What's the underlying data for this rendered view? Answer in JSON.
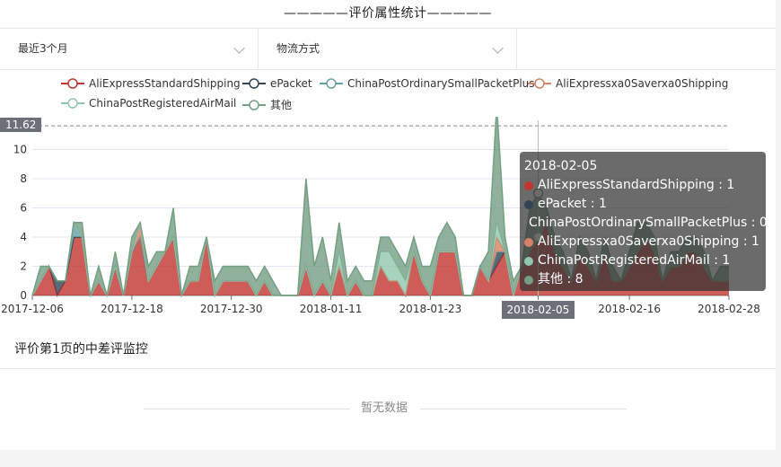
{
  "page": {
    "title": "—————评价属性统计—————"
  },
  "filters": [
    {
      "label": "最近3个月"
    },
    {
      "label": "物流方式"
    },
    {
      "label": ""
    }
  ],
  "chart_data": {
    "type": "area",
    "stacked": true,
    "ylim": [
      0,
      12
    ],
    "yticks": [
      0,
      2,
      4,
      6,
      8,
      10
    ],
    "grid": true,
    "legend_position": "top",
    "x_start": "2017-12-06",
    "x_tick_labels": [
      "2017-12-06",
      "2017-12-18",
      "2017-12-30",
      "2018-01-11",
      "2018-01-23",
      "2018-02-05",
      "2018-02-16",
      "2018-02-28"
    ],
    "max_marker": 11.62,
    "highlight_date": "2018-02-05",
    "series": [
      {
        "name": "AliExpressStandardShipping",
        "color": "#c23531",
        "values": [
          0,
          1,
          2,
          0,
          1,
          4,
          4,
          0,
          1,
          0,
          2,
          0,
          3,
          4,
          1,
          2,
          3,
          4,
          0,
          1,
          1,
          4,
          0,
          1,
          1,
          1,
          1,
          0,
          1,
          0,
          0,
          0,
          0,
          2,
          0,
          1,
          0,
          2,
          0,
          1,
          0,
          0,
          2,
          1,
          1,
          0,
          3,
          1,
          0,
          3,
          3,
          3,
          0,
          0,
          2,
          1,
          2,
          3,
          0,
          2,
          3,
          4,
          5,
          3,
          2,
          1,
          3,
          2,
          1,
          3,
          1,
          1,
          2,
          3,
          4,
          3,
          1,
          2,
          2,
          3,
          3,
          2,
          1,
          1,
          1
        ]
      },
      {
        "name": "ePacket",
        "color": "#2f4554",
        "values": [
          0,
          0,
          0,
          1,
          0,
          0,
          0,
          0,
          0,
          0,
          0,
          0,
          0,
          0,
          0,
          0,
          0,
          0,
          0,
          0,
          0,
          0,
          0,
          0,
          0,
          0,
          0,
          0,
          0,
          0,
          0,
          0,
          0,
          0,
          0,
          0,
          0,
          0,
          0,
          0,
          0,
          0,
          0,
          0,
          0,
          0,
          0,
          0,
          0,
          0,
          0,
          0,
          0,
          0,
          0,
          0,
          1,
          0,
          0,
          0,
          0,
          0,
          0,
          0,
          0,
          0,
          0,
          0,
          0,
          0,
          0,
          0,
          0,
          0,
          0,
          0,
          0,
          0,
          0,
          0,
          0,
          0,
          0,
          0,
          0
        ]
      },
      {
        "name": "ChinaPostOrdinarySmallPacketPlus",
        "color": "#61a0a8",
        "values": [
          0,
          0,
          0,
          0,
          0,
          1,
          0,
          0,
          0,
          0,
          0,
          0,
          0,
          0,
          0,
          0,
          0,
          0,
          0,
          0,
          0,
          0,
          0,
          0,
          0,
          0,
          0,
          0,
          0,
          0,
          0,
          0,
          0,
          0,
          0,
          0,
          0,
          0,
          0,
          0,
          0,
          0,
          0,
          0,
          0,
          0,
          0,
          0,
          0,
          0,
          0,
          0,
          0,
          0,
          0,
          0,
          0,
          0,
          0,
          0,
          0,
          0,
          0,
          0,
          0,
          0,
          0,
          0,
          0,
          0,
          0,
          0,
          0,
          0,
          0,
          0,
          0,
          0,
          0,
          0,
          0,
          0,
          0,
          0,
          0
        ]
      },
      {
        "name": "AliExpressxa0Saverxa0Shipping",
        "color": "#d48265",
        "values": [
          0,
          0,
          0,
          0,
          0,
          0,
          0,
          0,
          0,
          0,
          0,
          0,
          0,
          1,
          0,
          0,
          0,
          0,
          0,
          0,
          0,
          0,
          0,
          0,
          0,
          0,
          0,
          0,
          0,
          0,
          0,
          0,
          0,
          0,
          0,
          0,
          0,
          0,
          0,
          0,
          0,
          0,
          0,
          0,
          0,
          0,
          0,
          0,
          0,
          0,
          0,
          0,
          0,
          0,
          0,
          0,
          1,
          0,
          0,
          0,
          0,
          0,
          0,
          0,
          0,
          0,
          0,
          0,
          0,
          0,
          0,
          0,
          0,
          0,
          0,
          0,
          0,
          0,
          0,
          0,
          0,
          0,
          0,
          0,
          0
        ]
      },
      {
        "name": "ChinaPostRegisteredAirMail",
        "color": "#91c7ae",
        "values": [
          0,
          0,
          0,
          0,
          0,
          0,
          0,
          0,
          0,
          0,
          0,
          0,
          0,
          0,
          0,
          0,
          0,
          0,
          0,
          0,
          0,
          0,
          0,
          0,
          0,
          0,
          0,
          0,
          0,
          0,
          0,
          0,
          0,
          0,
          0,
          0,
          0,
          1,
          0,
          0,
          0,
          0,
          1,
          2,
          1,
          1,
          0,
          0,
          0,
          0,
          0,
          0,
          0,
          0,
          0,
          0,
          1,
          0,
          0,
          0,
          0,
          0,
          0,
          0,
          0,
          0,
          0,
          0,
          0,
          0,
          0,
          0,
          0,
          0,
          0,
          0,
          0,
          0,
          0,
          0,
          0,
          0,
          0,
          0,
          0
        ]
      },
      {
        "name": "其他",
        "color": "#749f83",
        "values": [
          0,
          1,
          0,
          0,
          0,
          0,
          1,
          0,
          1,
          0,
          1,
          0,
          1,
          0,
          1,
          1,
          0,
          2,
          0,
          1,
          1,
          0,
          1,
          1,
          1,
          1,
          1,
          1,
          1,
          1,
          0,
          0,
          0,
          6,
          2,
          3,
          1,
          2,
          1,
          1,
          1,
          1,
          1,
          1,
          1,
          1,
          1,
          1,
          2,
          1,
          2,
          1,
          0,
          0,
          0,
          2,
          8,
          1,
          1,
          0,
          3,
          3,
          1,
          1,
          1,
          0,
          1,
          1,
          0,
          1,
          1,
          0,
          1,
          2,
          1,
          1,
          0,
          1,
          1,
          1,
          1,
          1,
          0,
          1,
          1
        ]
      }
    ]
  },
  "tooltip": {
    "date": "2018-02-05",
    "rows": [
      {
        "text": "AliExpressStandardShipping : 1",
        "color": "#c23531"
      },
      {
        "text": "ePacket : 1",
        "color": "#2f4554"
      },
      {
        "text": "ChinaPostOrdinarySmallPacketPlus : 0",
        "color": "#61a0a8"
      },
      {
        "text": "AliExpressxa0Saverxa0Shipping : 1",
        "color": "#d48265"
      },
      {
        "text": "ChinaPostRegisteredAirMail : 1",
        "color": "#91c7ae"
      },
      {
        "text": "其他 : 8",
        "color": "#749f83"
      }
    ]
  },
  "monitor": {
    "title": "评价第1页的中差评监控",
    "empty_text": "暂无数据"
  }
}
